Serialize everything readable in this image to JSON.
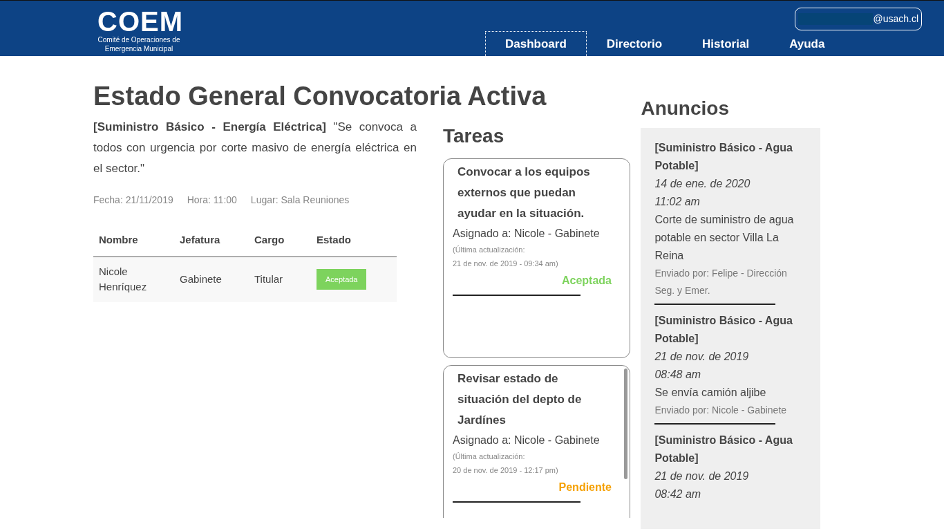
{
  "header": {
    "logo": "COEM",
    "logo_subtitle": "Comité de Operaciones de Emergencia Municipal",
    "nav": [
      {
        "label": "Dashboard",
        "selected": true
      },
      {
        "label": "Directorio",
        "selected": false
      },
      {
        "label": "Historial",
        "selected": false
      },
      {
        "label": "Ayuda",
        "selected": false
      }
    ],
    "user_email": "@usach.cl"
  },
  "title": "Estado General Convocatoria Activa",
  "description": "**[Suministro Básico - Energía Eléctrica]** \"Se convoca a todos con urgencia por corte masivo de energía eléctrica en el sector.\"",
  "meta": [
    "Fecha: 21/11/2019",
    "Hora: 11:00",
    "Lugar: Sala Reuniones"
  ],
  "table": {
    "columns": [
      "Nombre",
      "Jefatura",
      "Cargo",
      "Estado"
    ],
    "rows": [
      {
        "cells": [
          "Nicole Henríquez",
          "Gabinete",
          "Titular"
        ],
        "status": "Aceptada",
        "kind": "accepted"
      }
    ]
  },
  "tasks": {
    "title": "Tareas",
    "items": [
      {
        "title": "Convocar a los equipos externos que puedan ayudar en la situación.",
        "assigned": "Asignado a: Nicole - Gabinete",
        "updated_label": "(Última actualización:",
        "updated": "21 de nov. de 2019 - 09:34 am)",
        "status": "Aceptada",
        "kind": "accepted"
      },
      {
        "title": "Revisar estado de situación del depto de Jardínes",
        "assigned": "Asignado a: Nicole - Gabinete",
        "updated_label": "(Última actualización:",
        "updated": "20 de nov. de 2019 - 12:17 pm)",
        "status": "Pendiente",
        "kind": "pending"
      }
    ]
  },
  "announcements": {
    "title": "Anuncios",
    "items": [
      {
        "topic": "[Suministro Básico - Agua Potable]",
        "date": "14 de ene. de 2020",
        "time": "11:02 am",
        "body": "Corte de suministro de agua potable en sector Villa La Reina",
        "sender": "Enviado por: Felipe - Dirección Seg. y Emer."
      },
      {
        "topic": "[Suministro Básico - Agua Potable]",
        "date": "21 de nov. de 2019",
        "time": "08:48 am",
        "body": "Se envía camión aljibe",
        "sender": "Enviado por: Nicole - Gabinete"
      },
      {
        "topic": "[Suministro Básico - Agua Potable]",
        "date": "21 de nov. de 2019",
        "time": "08:42 am"
      }
    ]
  }
}
